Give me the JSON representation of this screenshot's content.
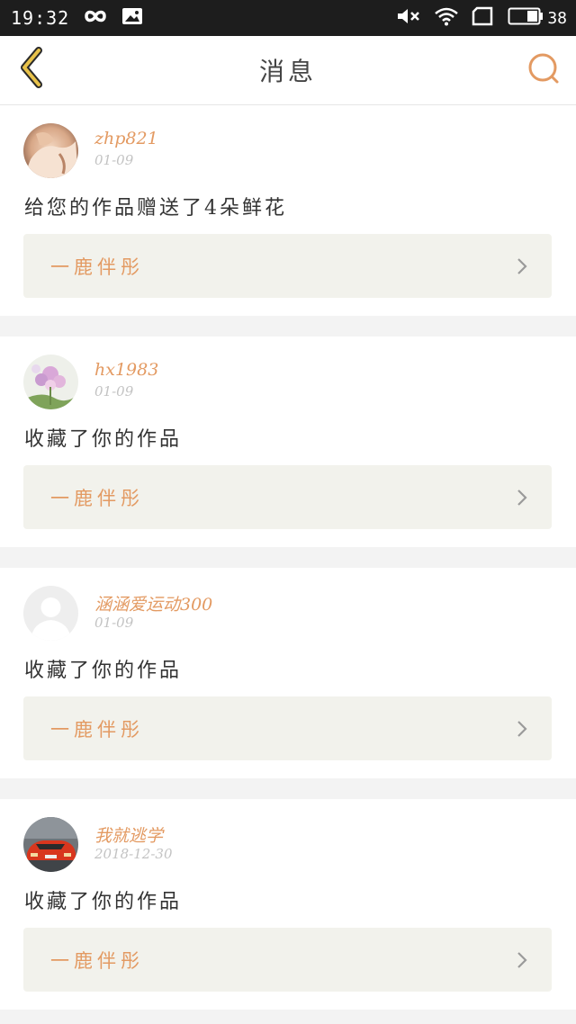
{
  "status_bar": {
    "time": "19:32",
    "battery": "38",
    "icons": [
      "infinity-icon",
      "image-icon",
      "mute-icon",
      "wifi-icon",
      "sim-icon",
      "battery-icon"
    ]
  },
  "nav": {
    "title": "消息",
    "back_icon": "chevron-left-icon",
    "search_icon": "search-icon"
  },
  "colors": {
    "accent": "#e39a62",
    "back_icon": "#e8c24a",
    "status_bar_bg": "#1d1d1d",
    "card_bg": "#ffffff",
    "link_bg": "#f2f2ec",
    "page_bg": "#f3f3f3"
  },
  "messages": [
    {
      "username": "zhp821",
      "date": "01-09",
      "text": "给您的作品赠送了4朵鲜花",
      "work_title": "一鹿伴彤",
      "avatar": "avatar-photo-hands"
    },
    {
      "username": "hx1983",
      "date": "01-09",
      "text": "收藏了你的作品",
      "work_title": "一鹿伴彤",
      "avatar": "avatar-photo-flowers"
    },
    {
      "username": "涵涵爱运动300",
      "date": "01-09",
      "text": "收藏了你的作品",
      "work_title": "一鹿伴彤",
      "avatar": "avatar-default"
    },
    {
      "username": "我就逃学",
      "date": "2018-12-30",
      "text": "收藏了你的作品",
      "work_title": "一鹿伴彤",
      "avatar": "avatar-photo-car"
    }
  ]
}
